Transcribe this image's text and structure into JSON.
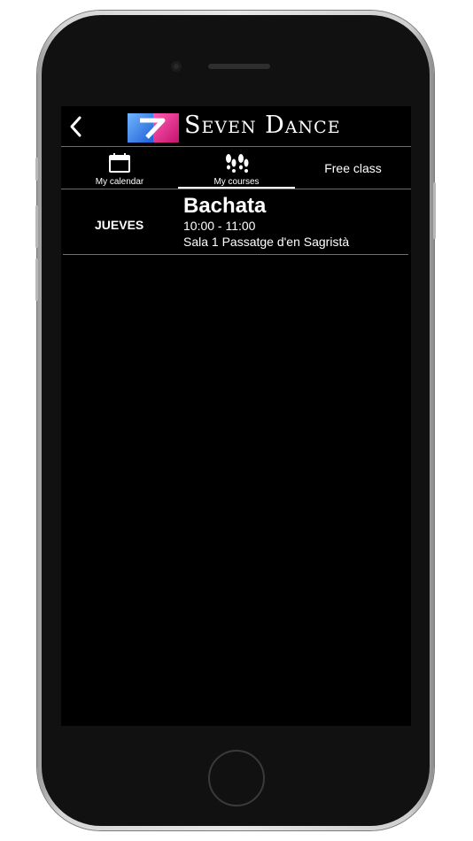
{
  "header": {
    "back_icon": "chevron-left-icon",
    "brand_name": "Seven Dance",
    "logo_colors": {
      "pink": "#e8268f",
      "blue": "#2a7fe6"
    }
  },
  "tabs": [
    {
      "label": "My calendar",
      "icon": "calendar-icon",
      "active": false
    },
    {
      "label": "My courses",
      "icon": "footprints-icon",
      "active": true
    },
    {
      "label": "Free class",
      "icon": null,
      "active": false
    }
  ],
  "courses": [
    {
      "day": "JUEVES",
      "name": "Bachata",
      "time": "10:00 - 11:00",
      "room": "Sala 1 Passatge d'en Sagristà"
    }
  ],
  "colors": {
    "background": "#000000",
    "text": "#ffffff",
    "divider": "#6e6e6e"
  }
}
